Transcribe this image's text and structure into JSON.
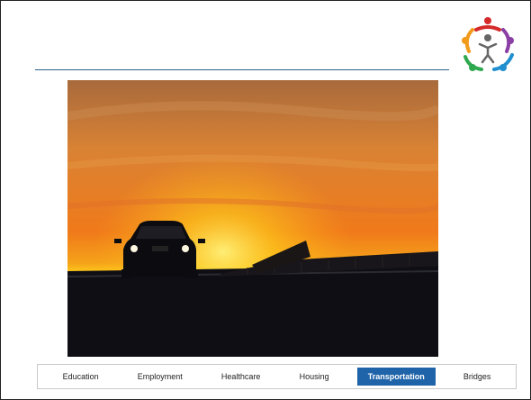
{
  "header": {
    "logo_icon": "people-circle-logo-icon",
    "rule_color": "#2a5f86"
  },
  "photo": {
    "icon": "car-at-sunset-photo",
    "sky_top": "#a86a3c",
    "sky_mid": "#f07a1a",
    "horizon": "#ffcf1a"
  },
  "nav": {
    "items": [
      {
        "label": "Education",
        "active": false
      },
      {
        "label": "Employment",
        "active": false
      },
      {
        "label": "Healthcare",
        "active": false
      },
      {
        "label": "Housing",
        "active": false
      },
      {
        "label": "Transportation",
        "active": true
      },
      {
        "label": "Bridges",
        "active": false
      }
    ],
    "active_color": "#1f63a8"
  }
}
